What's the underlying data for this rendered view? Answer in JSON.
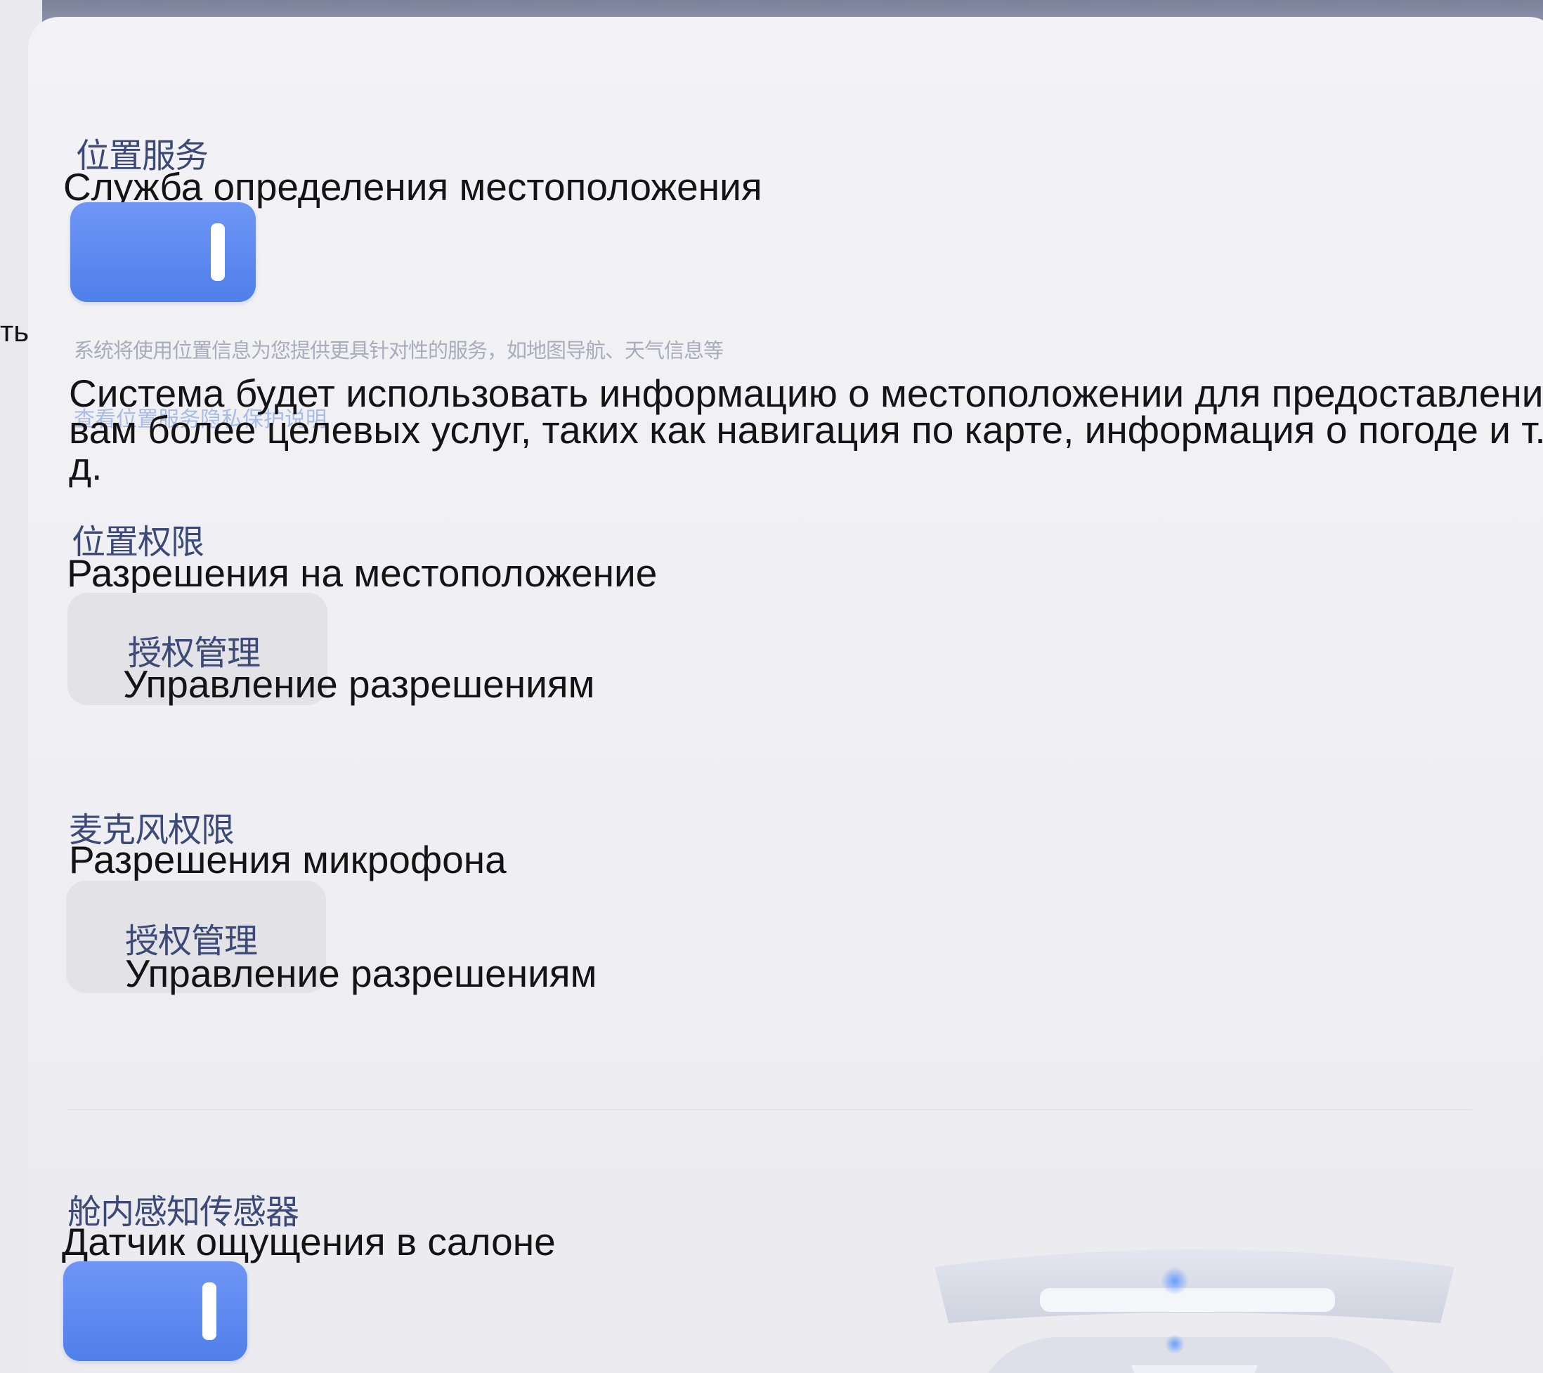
{
  "left_edge": {
    "cut_text": "ть"
  },
  "location_service": {
    "title_zh": "位置服务",
    "title_ru": "Служба определения местоположения",
    "toggle_on": true,
    "description_zh": "系统将使用位置信息为您提供更具针对性的服务，如地图导航、天气信息等",
    "description_ru": "Система будет использовать информацию о местоположении для предоставления вам более целевых услуг, таких как навигация по карте, информация о погоде и т. д.",
    "link_zh": "查看位置服务隐私保护说明"
  },
  "location_permissions": {
    "title_zh": "位置权限",
    "title_ru": "Разрешения на местоположение",
    "button_zh": "授权管理",
    "button_ru": "Управление разрешениям"
  },
  "microphone_permissions": {
    "title_zh": "麦克风权限",
    "title_ru": "Разрешения микрофона",
    "button_zh": "授权管理",
    "button_ru": "Управление разрешениям"
  },
  "cabin_sensor": {
    "title_zh": "舱内感知传感器",
    "title_ru": "Датчик ощущения в салоне",
    "toggle_on": true
  },
  "colors": {
    "accent": "#5b87ef",
    "panel_bg": "#f1f1f4",
    "heading_zh": "#3d4a78"
  }
}
